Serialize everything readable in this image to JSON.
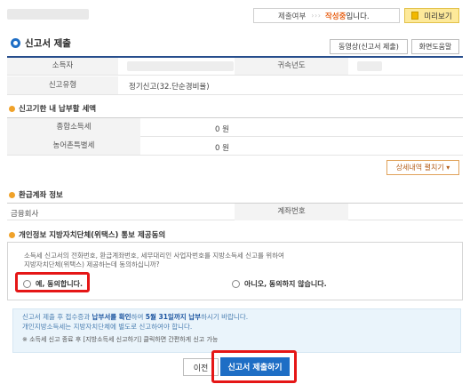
{
  "top": {
    "status_label": "제출여부",
    "status_arrows": "› › ›",
    "status_current": "작성중",
    "status_suffix": "입니다.",
    "preview": "미리보기"
  },
  "header": {
    "title": "신고서 제출",
    "video_btn": "동영상(신고서 제출)",
    "help_btn": "화면도움말"
  },
  "info_table": {
    "taxpayer_label": "소득자",
    "year_label": "귀속년도",
    "type_label": "신고유형",
    "type_value": "정기신고(32.단순경비율)"
  },
  "payment": {
    "heading": "신고기한 내 납부할 세액",
    "rows": [
      {
        "label": "종합소득세",
        "value": "0 원"
      },
      {
        "label": "농어촌특별세",
        "value": "0 원"
      }
    ],
    "detail_btn": "상세내역 펼치기 ▾"
  },
  "refund": {
    "heading": "환급계좌 정보",
    "bank_label": "금융회사",
    "account_label": "계좌번호"
  },
  "consent": {
    "heading": "개인정보 지방자치단체(위택스) 통보 제공동의",
    "text_line1": "소득세 신고서의 전화번호, 환급계좌번호, 세무대리인 사업자번호를 지방소득세 신고를 위하여",
    "text_line2": "지방자치단체(위택스) 제공하는데 동의하십니까?",
    "agree": "예, 동의합니다.",
    "disagree": "아니오, 동의하지 않습니다."
  },
  "notice": {
    "line1_pre": "신고서 제출 후 접수증과 ",
    "line1_bold1": "납부서를 확인",
    "line1_mid": "하여 ",
    "line1_bold2": "5월 31일까지 납부",
    "line1_post": "하시기 바랍니다.",
    "line2": "개인지방소득세는 지방자치단체에 별도로 신고하여야 합니다.",
    "line3": "※ 소득세 신고 종료 후 [지방소득세 신고하기] 클릭하면 간편하게 신고 가능"
  },
  "footer": {
    "prev": "이전",
    "submit": "신고서 제출하기"
  },
  "colors": {
    "accent_blue": "#1e6ec5",
    "header_line": "#264d8c",
    "status_orange": "#e8641b",
    "highlight_red": "#e51616"
  }
}
